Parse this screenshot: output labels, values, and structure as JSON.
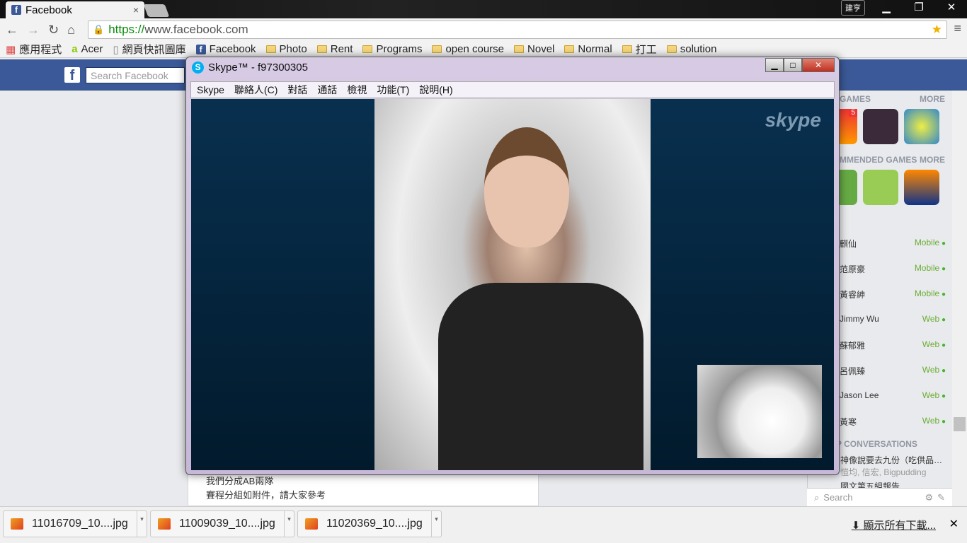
{
  "browser": {
    "tab_title": "Facebook",
    "url_scheme": "https://",
    "url_host": "www.facebook.com",
    "user_badge": "建亨",
    "bookmarks": [
      {
        "label": "應用程式",
        "icon": "apps"
      },
      {
        "label": "Acer",
        "icon": "acer"
      },
      {
        "label": "網頁快訊圖庫",
        "icon": "page"
      },
      {
        "label": "Facebook",
        "icon": "facebook"
      },
      {
        "label": "Photo",
        "icon": "folder"
      },
      {
        "label": "Rent",
        "icon": "folder"
      },
      {
        "label": "Programs",
        "icon": "folder"
      },
      {
        "label": "open course",
        "icon": "folder"
      },
      {
        "label": "Novel",
        "icon": "folder"
      },
      {
        "label": "Normal",
        "icon": "folder"
      },
      {
        "label": "打工",
        "icon": "folder"
      },
      {
        "label": "solution",
        "icon": "folder"
      }
    ]
  },
  "facebook": {
    "search_placeholder": "Search Facebook",
    "post_lines": [
      "我們分成AB兩隊",
      "賽程分組如附件，請大家參考"
    ],
    "games_header": "GAMES",
    "recommended_header": "MMENDED GAMES",
    "more": "MORE",
    "badge": "5",
    "friends": [
      {
        "name": "麒仙",
        "status": "Mobile"
      },
      {
        "name": "范原豪",
        "status": "Mobile"
      },
      {
        "name": "黃睿紳",
        "status": "Mobile"
      },
      {
        "name": "Jimmy Wu",
        "status": "Web"
      },
      {
        "name": "蘇郁雅",
        "status": "Web"
      },
      {
        "name": "呂佩臻",
        "status": "Web"
      },
      {
        "name": "Jason Lee",
        "status": "Web"
      },
      {
        "name": "黃寒",
        "status": "Web"
      }
    ],
    "conversations_header": "P CONVERSATIONS",
    "conversation_title": "神像說要去九份（吃供品…",
    "conversation_members": "愷均, 信宏, Bigpudding",
    "conversation2": "國文第五組報告",
    "chat_search": "Search"
  },
  "skype": {
    "title": "Skype™ - f97300305",
    "menu": [
      "Skype",
      "聯絡人(C)",
      "對話",
      "通話",
      "檢視",
      "功能(T)",
      "說明(H)"
    ],
    "watermark": "skype"
  },
  "downloads": {
    "files": [
      "11016709_10....jpg",
      "11009039_10....jpg",
      "11020369_10....jpg"
    ],
    "show_all": "顯示所有下載..."
  }
}
